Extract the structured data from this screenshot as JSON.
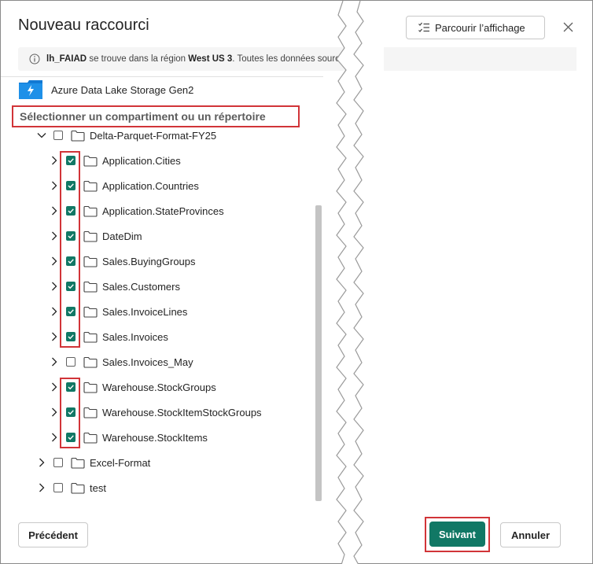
{
  "dialog": {
    "title": "Nouveau raccourci",
    "browse_label": "Parcourir l’affichage",
    "close_label": "Fermer"
  },
  "info": {
    "item_name": "lh_FAIAD",
    "text_before_region": " se trouve dans la région ",
    "region": "West US 3",
    "text_after_region": ". Toutes les données source"
  },
  "source": {
    "name": "Azure Data Lake Storage Gen2",
    "icon": "azure-data-lake-icon"
  },
  "section_label": "Sélectionner un compartiment ou un répertoire",
  "tree": {
    "root": {
      "label": "Delta-Parquet-Format-FY25",
      "expanded": true,
      "checked": false
    },
    "children": [
      {
        "label": "Application.Cities",
        "checked": true
      },
      {
        "label": "Application.Countries",
        "checked": true
      },
      {
        "label": "Application.StateProvinces",
        "checked": true
      },
      {
        "label": "DateDim",
        "checked": true
      },
      {
        "label": "Sales.BuyingGroups",
        "checked": true
      },
      {
        "label": "Sales.Customers",
        "checked": true
      },
      {
        "label": "Sales.InvoiceLines",
        "checked": true
      },
      {
        "label": "Sales.Invoices",
        "checked": true
      },
      {
        "label": "Sales.Invoices_May",
        "checked": false
      },
      {
        "label": "Warehouse.StockGroups",
        "checked": true
      },
      {
        "label": "Warehouse.StockItemStockGroups",
        "checked": true
      },
      {
        "label": "Warehouse.StockItems",
        "checked": true
      }
    ],
    "siblings": [
      {
        "label": "Excel-Format",
        "checked": false
      },
      {
        "label": "test",
        "checked": false
      }
    ]
  },
  "footer": {
    "previous_label": "Précédent",
    "next_label": "Suivant",
    "cancel_label": "Annuler"
  },
  "colors": {
    "accent": "#117865",
    "highlight": "#d13438"
  }
}
